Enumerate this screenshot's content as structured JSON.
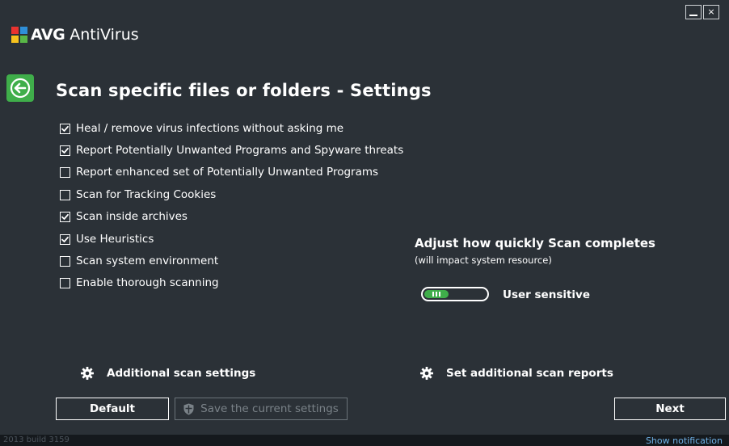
{
  "window": {
    "brand_avg": "AVG",
    "brand_product": "AntiVirus",
    "minimize_label": "minimize",
    "close_label": "×"
  },
  "page": {
    "title": "Scan specific files or folders - Settings"
  },
  "options": [
    {
      "label": "Heal / remove virus infections without asking me",
      "checked": true
    },
    {
      "label": "Report Potentially Unwanted Programs and Spyware threats",
      "checked": true
    },
    {
      "label": "Report enhanced set of Potentially Unwanted Programs",
      "checked": false
    },
    {
      "label": "Scan for Tracking Cookies",
      "checked": false
    },
    {
      "label": "Scan inside archives",
      "checked": true
    },
    {
      "label": "Use Heuristics",
      "checked": true
    },
    {
      "label": "Scan system environment",
      "checked": false
    },
    {
      "label": "Enable thorough scanning",
      "checked": false
    }
  ],
  "speed": {
    "title": "Adjust how quickly Scan completes",
    "subtitle": "(will impact system resource)",
    "value_label": "User sensitive",
    "level": 0.4
  },
  "links": {
    "additional": "Additional scan settings",
    "reports": "Set additional scan reports"
  },
  "buttons": {
    "default": "Default",
    "save": "Save the current settings",
    "next": "Next"
  },
  "footer": {
    "build": "2013  build 3159",
    "notification": "Show notification"
  },
  "colors": {
    "background": "#2b3137",
    "accent_green": "#3fae4a",
    "link_blue": "#6fb1e6"
  },
  "icons": {
    "logo": "avg-logo-icon",
    "back": "back-arrow-icon",
    "gear": "gear-icon",
    "shield": "shield-icon"
  }
}
